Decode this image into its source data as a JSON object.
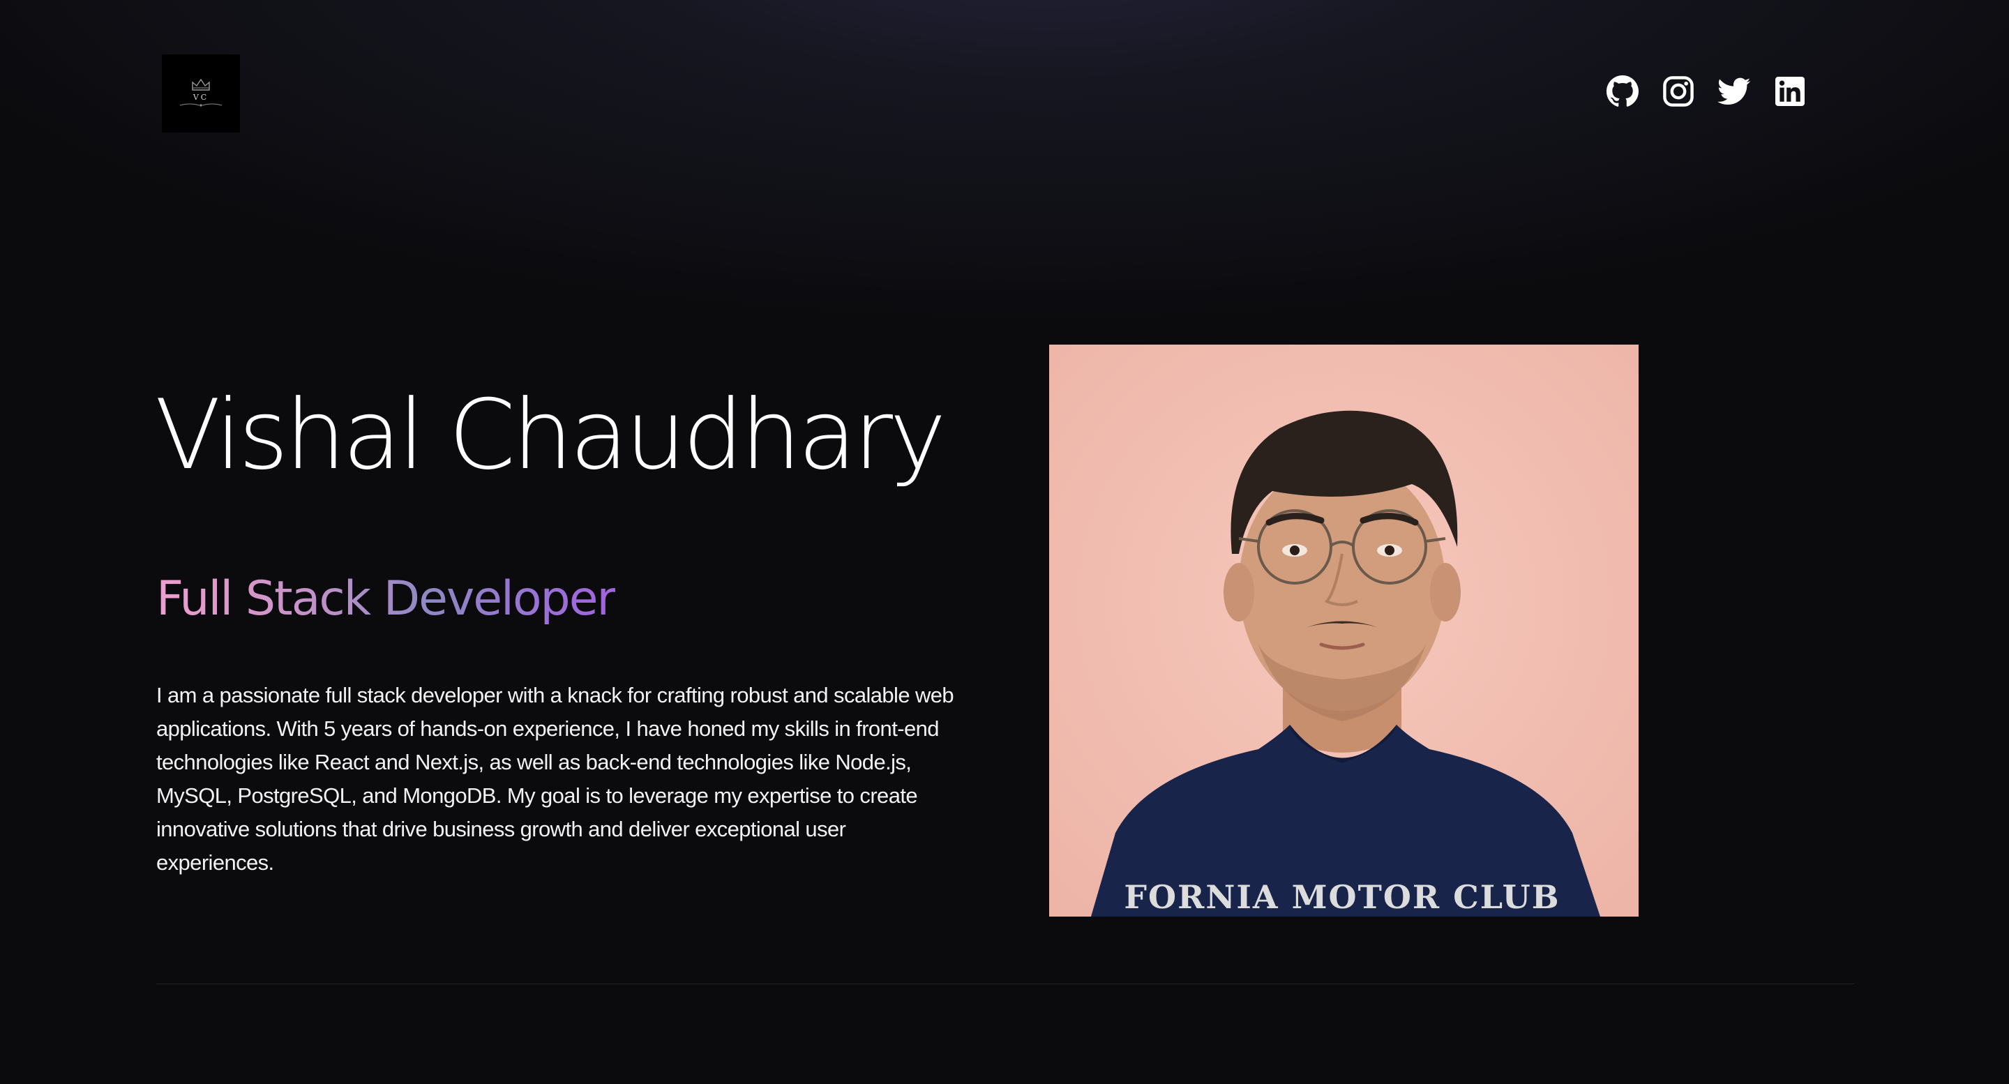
{
  "header": {
    "logo": {
      "initials": "VC",
      "icon": "crown-icon"
    },
    "social_links": [
      {
        "name": "GitHub",
        "icon": "github-icon"
      },
      {
        "name": "Instagram",
        "icon": "instagram-icon"
      },
      {
        "name": "Twitter",
        "icon": "twitter-icon"
      },
      {
        "name": "LinkedIn",
        "icon": "linkedin-icon"
      }
    ]
  },
  "hero": {
    "name": "Vishal Chaudhary",
    "role": "Full Stack Developer",
    "bio": "I am a passionate full stack developer with a knack for crafting robust and scalable web applications. With 5 years of hands-on experience, I have honed my skills in front-end technologies like React and Next.js, as well as back-end technologies like Node.js, MySQL, PostgreSQL, and MongoDB. My goal is to leverage my expertise to create innovative solutions that drive business growth and deliver exceptional user experiences.",
    "photo": {
      "shirt_text": "FORNIA MOTOR CLUB"
    }
  },
  "colors": {
    "background": "#0b0b0e",
    "text": "#ffffff",
    "role_gradient_start": "#ef9fd0",
    "role_gradient_end": "#a263e0",
    "photo_background": "#f3c0b4"
  }
}
